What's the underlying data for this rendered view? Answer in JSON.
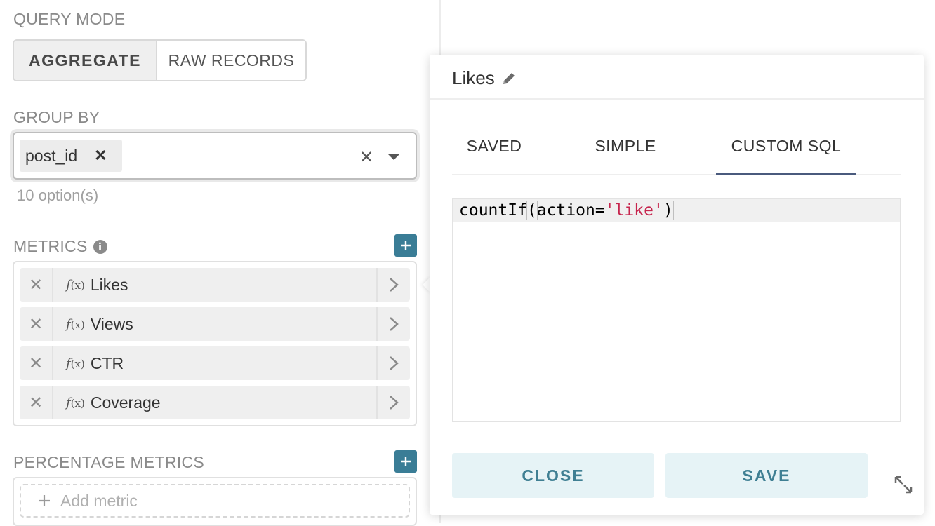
{
  "query_mode": {
    "label": "QUERY MODE",
    "options": [
      "AGGREGATE",
      "RAW RECORDS"
    ],
    "selected": "AGGREGATE"
  },
  "group_by": {
    "label": "GROUP BY",
    "selected_chips": [
      "post_id"
    ],
    "hint": "10 option(s)"
  },
  "metrics": {
    "label": "METRICS",
    "items": [
      {
        "fx_label": "f",
        "fx_paren": "(x)",
        "label": "Likes"
      },
      {
        "fx_label": "f",
        "fx_paren": "(x)",
        "label": "Views"
      },
      {
        "fx_label": "f",
        "fx_paren": "(x)",
        "label": "CTR"
      },
      {
        "fx_label": "f",
        "fx_paren": "(x)",
        "label": "Coverage"
      }
    ]
  },
  "percentage_metrics": {
    "label": "PERCENTAGE METRICS",
    "add_placeholder": "Add metric"
  },
  "popover": {
    "title": "Likes",
    "tabs": [
      "SAVED",
      "SIMPLE",
      "CUSTOM SQL"
    ],
    "active_tab": "CUSTOM SQL",
    "sql": {
      "func": "countIf",
      "open": "(",
      "arg": "action=",
      "literal": "'like'",
      "close": ")"
    },
    "close_label": "CLOSE",
    "save_label": "SAVE"
  },
  "colors": {
    "accent": "#3a7d96",
    "tab_underline": "#4a5a7d",
    "button_bg": "#e6f3f6",
    "sql_string": "#c7254e"
  },
  "icons": [
    "info-icon",
    "plus-icon",
    "pencil-icon",
    "close-icon",
    "chevron-down-icon",
    "chevron-right-icon",
    "expand-icon"
  ]
}
